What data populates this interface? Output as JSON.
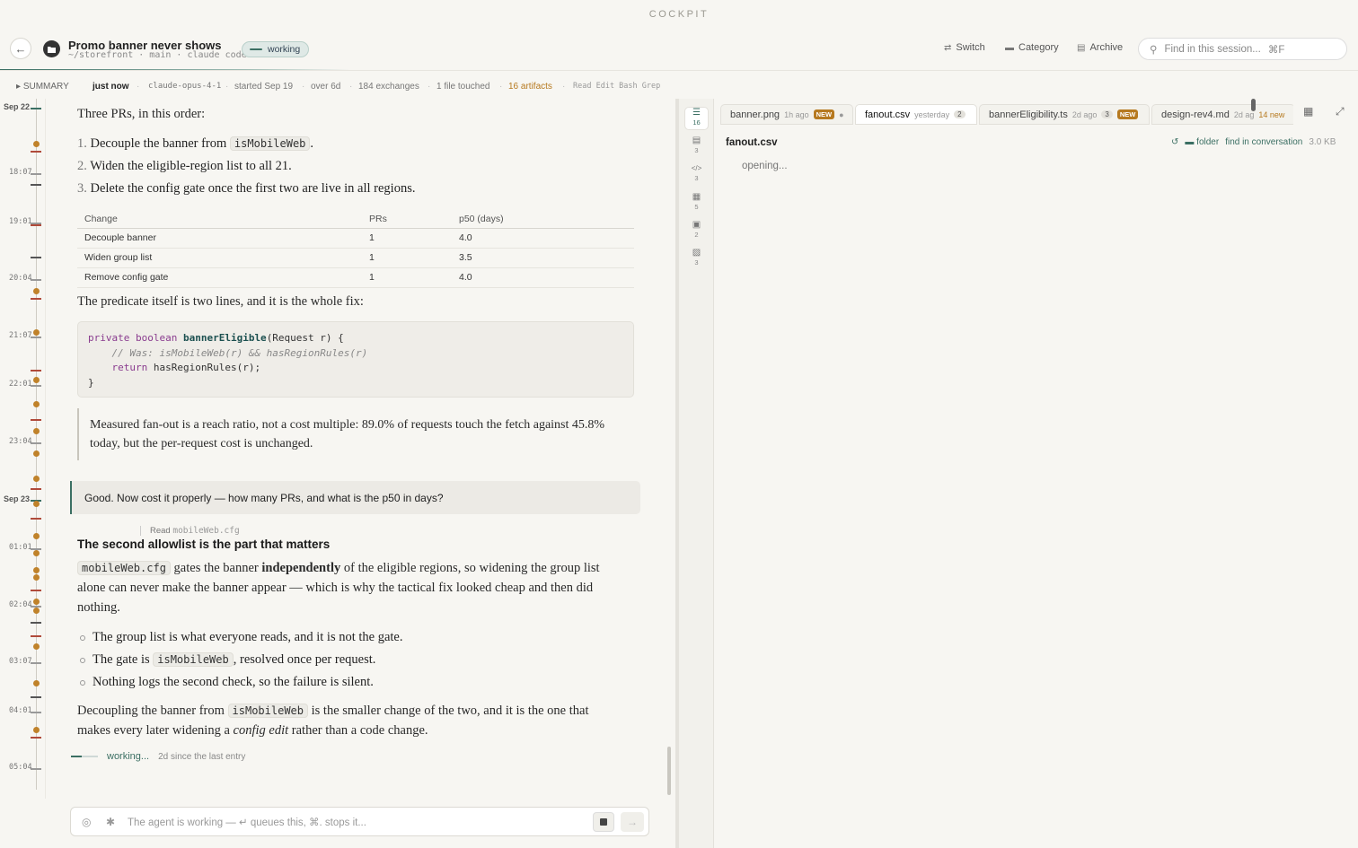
{
  "brand": "COCKPIT",
  "header": {
    "title": "Promo banner never shows",
    "subtitle": "~/storefront · main · claude code",
    "status": "working",
    "actions": {
      "switch": "Switch",
      "category": "Category",
      "archive": "Archive"
    },
    "search_placeholder": "Find in this session...",
    "search_shortcut": "⌘F"
  },
  "summary": {
    "toggle": "SUMMARY",
    "updated": "just now",
    "model": "claude-opus-4-1",
    "started": "started Sep 19",
    "duration": "over 6d",
    "exchanges": "184 exchanges",
    "files": "1 file touched",
    "artifacts": "16 artifacts",
    "tools": "Read Edit Bash Grep"
  },
  "timeline": {
    "labels": [
      "Sep 22",
      "18:07",
      "19:01",
      "20:04",
      "21:07",
      "22:01",
      "23:04",
      "Sep 23",
      "01:01",
      "02:04",
      "03:07",
      "04:01",
      "05:04"
    ]
  },
  "conversation": {
    "intro": "Three PRs, in this order:",
    "steps": [
      {
        "pre": "Decouple the banner from ",
        "code": "isMobileWeb",
        "post": "."
      },
      {
        "pre": "Widen the eligible-region list to all 21.",
        "code": "",
        "post": ""
      },
      {
        "pre": "Delete the config gate once the first two are live in all regions.",
        "code": "",
        "post": ""
      }
    ],
    "table": {
      "headers": [
        "Change",
        "PRs",
        "p50 (days)"
      ],
      "rows": [
        [
          "Decouple banner",
          "1",
          "4.0"
        ],
        [
          "Widen group list",
          "1",
          "3.5"
        ],
        [
          "Remove config gate",
          "1",
          "4.0"
        ]
      ]
    },
    "predicate_intro": "The predicate itself is two lines, and it is the whole fix:",
    "code": {
      "l1_kw1": "private",
      "l1_kw2": "boolean",
      "l1_fn": "bannerEligible",
      "l1_rest": "(Request r) {",
      "l2": "// Was: isMobileWeb(r) && hasRegionRules(r)",
      "l3_kw": "return",
      "l3_rest": " hasRegionRules(r);",
      "l4": "}"
    },
    "quote": "Measured fan-out is a reach ratio, not a cost multiple: 89.0% of requests touch the fetch against 45.8% today, but the per-request cost is unchanged.",
    "user_message": "Good. Now cost it properly — how many PRs, and what is the p50 in days?",
    "tool_call": {
      "verb": "Read",
      "target": "mobileWeb.cfg"
    },
    "heading": "The second allowlist is the part that matters",
    "para1": {
      "code": "mobileWeb.cfg",
      "pre": " gates the banner ",
      "bold": "independently",
      "post": " of the eligible regions, so widening the group list alone can never make the banner appear — which is why the tactical fix looked cheap and then did nothing."
    },
    "bullets": [
      {
        "pre": "The group list is what everyone reads, and it is not the gate.",
        "code": "",
        "post": ""
      },
      {
        "pre": "The gate is ",
        "code": "isMobileWeb",
        "post": ", resolved once per request."
      },
      {
        "pre": "Nothing logs the second check, so the failure is silent.",
        "code": "",
        "post": ""
      }
    ],
    "para2": {
      "pre": "Decoupling the banner from ",
      "code": "isMobileWeb",
      "mid": " is the smaller change of the two, and it is the one that makes every later widening a ",
      "em": "config edit",
      "post": " rather than a code change."
    },
    "working": "working...",
    "since": "2d since the last entry"
  },
  "composer": {
    "placeholder": "The agent is working — ↵ queues this, ⌘. stops it..."
  },
  "artifacts": {
    "rail": [
      {
        "icon": "list-icon",
        "count": "16"
      },
      {
        "icon": "document-icon",
        "count": "3"
      },
      {
        "icon": "code-icon",
        "count": "3"
      },
      {
        "icon": "database-icon",
        "count": "5"
      },
      {
        "icon": "clipboard-icon",
        "count": "2"
      },
      {
        "icon": "image-icon",
        "count": "3"
      }
    ],
    "tabs": [
      {
        "name": "banner.png",
        "age": "1h ago",
        "badge": "NEW"
      },
      {
        "name": "fanout.csv",
        "age": "yesterday",
        "count": "2"
      },
      {
        "name": "bannerEligibility.ts",
        "age": "2d ago",
        "count": "3",
        "badge": "NEW"
      },
      {
        "name": "design-rev4.md",
        "age": "2d ag",
        "note": "14 new"
      }
    ],
    "open_file": {
      "name": "fanout.csv",
      "folder": "folder",
      "find": "find in conversation",
      "size": "3.0 KB",
      "status": "opening..."
    }
  },
  "colors": {
    "accent": "#3b6f63",
    "badge": "#b6791f",
    "timeline_red": "#b04a3a",
    "timeline_orange": "#c0822a"
  }
}
